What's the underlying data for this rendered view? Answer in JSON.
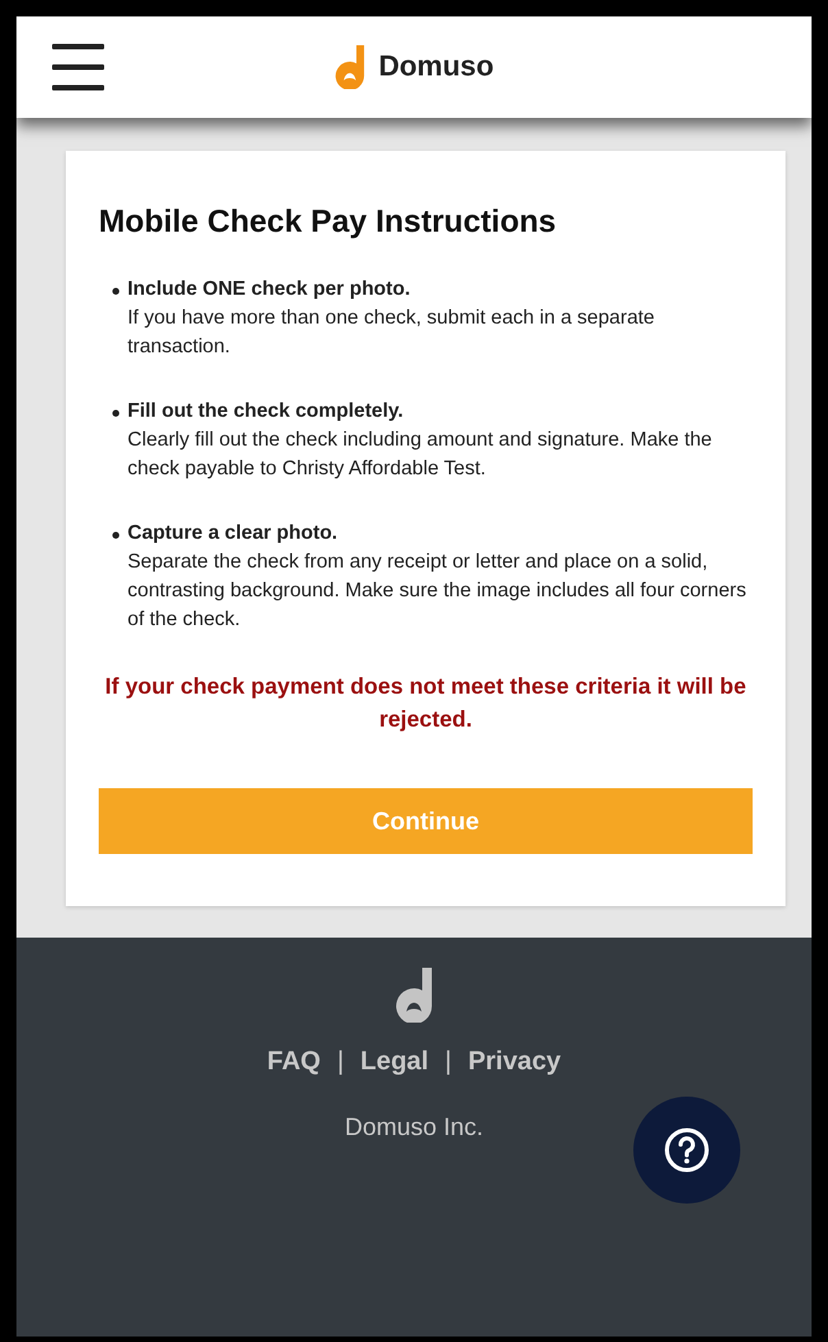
{
  "header": {
    "brand": "Domuso"
  },
  "card": {
    "title": "Mobile Check Pay Instructions",
    "instructions": [
      {
        "heading": "Include ONE check per photo.",
        "body": "If you have more than one check, submit each in a separate transaction."
      },
      {
        "heading": "Fill out the check completely.",
        "body": "Clearly fill out the check including amount and signature. Make the check payable to Christy Affordable Test."
      },
      {
        "heading": "Capture a clear photo.",
        "body": "Separate the check from any receipt or letter and place on a solid, contrasting background. Make sure the image includes all four corners of the check."
      }
    ],
    "warning": "If your check payment does not meet these criteria it will be rejected.",
    "button": "Continue"
  },
  "footer": {
    "links": [
      "FAQ",
      "Legal",
      "Privacy"
    ],
    "separator": "|",
    "company": "Domuso Inc."
  }
}
